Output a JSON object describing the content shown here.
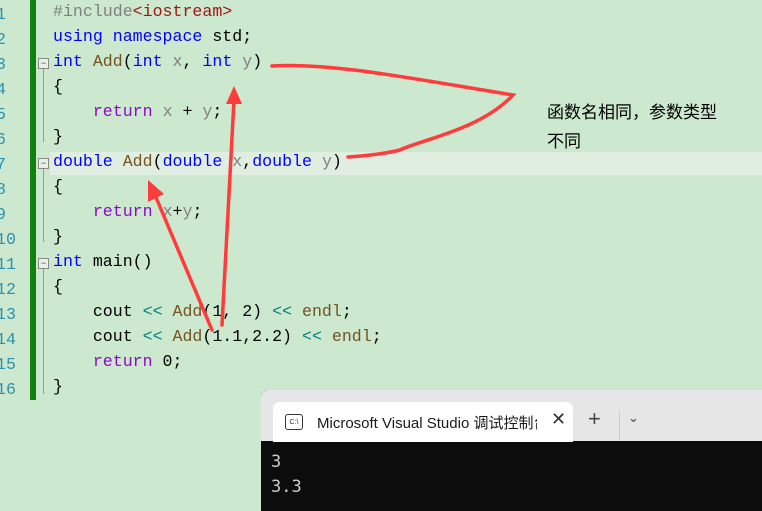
{
  "editor": {
    "line_numbers": [
      "1",
      "2",
      "3",
      "4",
      "5",
      "6",
      "7",
      "8",
      "9",
      "10",
      "11",
      "12",
      "13",
      "14",
      "15",
      "16"
    ],
    "lines": [
      [
        [
          "#include",
          "pp"
        ],
        [
          "<iostream>",
          "inc"
        ]
      ],
      [
        [
          "using",
          "kw"
        ],
        [
          " ",
          ""
        ],
        [
          "namespace",
          "kw"
        ],
        [
          " std;",
          ""
        ]
      ],
      [
        [
          "int",
          "kw"
        ],
        [
          " ",
          ""
        ],
        [
          "Add",
          "fn"
        ],
        [
          "(",
          ""
        ],
        [
          "int",
          "kw"
        ],
        [
          " ",
          ""
        ],
        [
          "x",
          "pr"
        ],
        [
          ", ",
          ""
        ],
        [
          "int",
          "kw"
        ],
        [
          " ",
          ""
        ],
        [
          "y",
          "pr"
        ],
        [
          ")",
          ""
        ]
      ],
      [
        [
          "{",
          ""
        ]
      ],
      [
        [
          "    ",
          ""
        ],
        [
          "return",
          "ret"
        ],
        [
          " ",
          ""
        ],
        [
          "x",
          "pr"
        ],
        [
          " + ",
          ""
        ],
        [
          "y",
          "pr"
        ],
        [
          ";",
          ""
        ]
      ],
      [
        [
          "}",
          ""
        ]
      ],
      [
        [
          "double",
          "kw"
        ],
        [
          " ",
          ""
        ],
        [
          "Add",
          "fn"
        ],
        [
          "(",
          ""
        ],
        [
          "double",
          "kw"
        ],
        [
          " ",
          ""
        ],
        [
          "x",
          "pr"
        ],
        [
          ",",
          ""
        ],
        [
          "double",
          "kw"
        ],
        [
          " ",
          ""
        ],
        [
          "y",
          "pr"
        ],
        [
          ")",
          ""
        ]
      ],
      [
        [
          "{",
          ""
        ]
      ],
      [
        [
          "    ",
          ""
        ],
        [
          "return",
          "ret"
        ],
        [
          " ",
          ""
        ],
        [
          "x",
          "pr"
        ],
        [
          "+",
          ""
        ],
        [
          "y",
          "pr"
        ],
        [
          ";",
          ""
        ]
      ],
      [
        [
          "}",
          ""
        ]
      ],
      [
        [
          "int",
          "kw"
        ],
        [
          " main()",
          ""
        ]
      ],
      [
        [
          "{",
          ""
        ]
      ],
      [
        [
          "    cout ",
          ""
        ],
        [
          "<<",
          "op"
        ],
        [
          " ",
          ""
        ],
        [
          "Add",
          "fn"
        ],
        [
          "(1, 2) ",
          ""
        ],
        [
          "<<",
          "op"
        ],
        [
          " ",
          ""
        ],
        [
          "endl",
          "fn"
        ],
        [
          ";",
          ""
        ]
      ],
      [
        [
          "    cout ",
          ""
        ],
        [
          "<<",
          "op"
        ],
        [
          " ",
          ""
        ],
        [
          "Add",
          "fn"
        ],
        [
          "(1.1,2.2) ",
          ""
        ],
        [
          "<<",
          "op"
        ],
        [
          " ",
          ""
        ],
        [
          "endl",
          "fn"
        ],
        [
          ";",
          ""
        ]
      ],
      [
        [
          "    ",
          ""
        ],
        [
          "return",
          "ret"
        ],
        [
          " 0;",
          ""
        ]
      ],
      [
        [
          "}",
          ""
        ]
      ]
    ]
  },
  "annotation": {
    "line1": "函数名相同，参数类型",
    "line2": "不同",
    "color": "#ff3333"
  },
  "terminal": {
    "tab_title": "Microsoft Visual Studio 调试控制台",
    "tab_icon": "C:\\",
    "close_icon": "✕",
    "new_tab_icon": "+",
    "dropdown_icon": "⌄",
    "output": [
      "3",
      "3.3"
    ]
  }
}
